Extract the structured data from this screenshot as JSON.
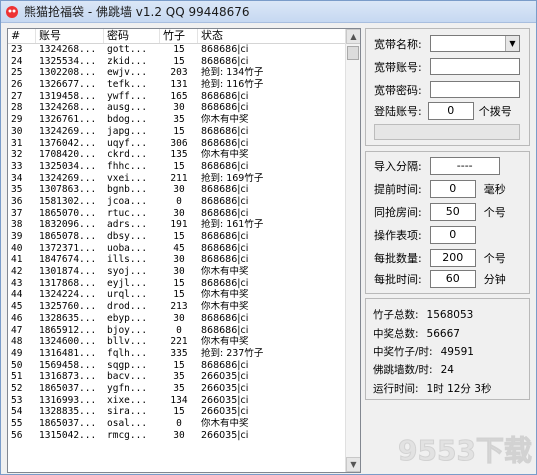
{
  "window": {
    "title": "熊猫抢福袋 - 佛跳墙 v1.2  QQ 99448676"
  },
  "table": {
    "headers": [
      "#",
      "账号",
      "密码",
      "竹子",
      "状态"
    ],
    "rows": [
      [
        "23",
        "1324268...",
        "gott...",
        "15",
        "868686|ci"
      ],
      [
        "24",
        "1325534...",
        "zkid...",
        "15",
        "868686|ci"
      ],
      [
        "25",
        "1302208...",
        "ewjv...",
        "203",
        "抢到: 134竹子"
      ],
      [
        "26",
        "1326677...",
        "tefk...",
        "131",
        "抢到: 116竹子"
      ],
      [
        "27",
        "1319458...",
        "ywff...",
        "165",
        "868686|ci"
      ],
      [
        "28",
        "1324268...",
        "ausg...",
        "30",
        "868686|ci"
      ],
      [
        "29",
        "1326761...",
        "bdog...",
        "35",
        "你木有中奖"
      ],
      [
        "30",
        "1324269...",
        "japg...",
        "15",
        "868686|ci"
      ],
      [
        "31",
        "1376042...",
        "uqyf...",
        "306",
        "868686|ci"
      ],
      [
        "32",
        "1708420...",
        "ckrd...",
        "135",
        "你木有中奖"
      ],
      [
        "33",
        "1325034...",
        "fhhc...",
        "15",
        "868686|ci"
      ],
      [
        "34",
        "1324269...",
        "vxei...",
        "211",
        "抢到: 169竹子"
      ],
      [
        "35",
        "1307863...",
        "bgnb...",
        "30",
        "868686|ci"
      ],
      [
        "36",
        "1581302...",
        "jcoa...",
        "0",
        "868686|ci"
      ],
      [
        "37",
        "1865070...",
        "rtuc...",
        "30",
        "868686|ci"
      ],
      [
        "38",
        "1832096...",
        "adrs...",
        "191",
        "抢到: 161竹子"
      ],
      [
        "39",
        "1865078...",
        "dbsy...",
        "15",
        "868686|ci"
      ],
      [
        "40",
        "1372371...",
        "uoba...",
        "45",
        "868686|ci"
      ],
      [
        "41",
        "1847674...",
        "ills...",
        "30",
        "868686|ci"
      ],
      [
        "42",
        "1301874...",
        "syoj...",
        "30",
        "你木有中奖"
      ],
      [
        "43",
        "1317868...",
        "eyjl...",
        "15",
        "868686|ci"
      ],
      [
        "44",
        "1324224...",
        "urql...",
        "15",
        "你木有中奖"
      ],
      [
        "45",
        "1325760...",
        "drod...",
        "213",
        "你木有中奖"
      ],
      [
        "46",
        "1328635...",
        "ebyp...",
        "30",
        "868686|ci"
      ],
      [
        "47",
        "1865912...",
        "bjoy...",
        "0",
        "868686|ci"
      ],
      [
        "48",
        "1324600...",
        "bllv...",
        "221",
        "你木有中奖"
      ],
      [
        "49",
        "1316481...",
        "fqlh...",
        "335",
        "抢到: 237竹子"
      ],
      [
        "50",
        "1569458...",
        "sqgp...",
        "15",
        "868686|ci"
      ],
      [
        "51",
        "1316873...",
        "bacv...",
        "35",
        "266035|ci"
      ],
      [
        "52",
        "1865037...",
        "ygfn...",
        "35",
        "266035|ci"
      ],
      [
        "53",
        "1316993...",
        "xixe...",
        "134",
        "266035|ci"
      ],
      [
        "54",
        "1328835...",
        "sira...",
        "15",
        "266035|ci"
      ],
      [
        "55",
        "1865037...",
        "osal...",
        "0",
        "你木有中奖"
      ],
      [
        "56",
        "1315042...",
        "rmcg...",
        "30",
        "266035|ci"
      ]
    ]
  },
  "panel1": {
    "broadband_name_label": "宽带名称:",
    "broadband_account_label": "宽带账号:",
    "broadband_password_label": "宽带密码:",
    "login_account_label": "登陆账号:",
    "login_account_value": "0",
    "dial_suffix": "个拨号"
  },
  "panel2": {
    "import_sep_label": "导入分隔:",
    "import_sep_value": "----",
    "advance_label": "提前时间:",
    "advance_value": "0",
    "advance_unit": "毫秒",
    "room_label": "同抢房间:",
    "room_value": "50",
    "room_unit": "个号",
    "op_label": "操作表项:",
    "op_value": "0",
    "batch_label": "每批数量:",
    "batch_value": "200",
    "batch_unit": "个号",
    "batch_time_label": "每批时间:",
    "batch_time_value": "60",
    "batch_time_unit": "分钟"
  },
  "stats": {
    "bamboo_total_label": "竹子总数:",
    "bamboo_total_value": "1568053",
    "win_total_label": "中奖总数:",
    "win_total_value": "56667",
    "rate_label": "中奖竹子/时:",
    "rate_value": "49591",
    "fotiaoqiang_label": "佛跳墙数/时:",
    "fotiaoqiang_value": "24",
    "runtime_label": "运行时间:",
    "runtime_value": "1时 12分 3秒"
  },
  "watermark": {
    "text": "9553下载"
  }
}
